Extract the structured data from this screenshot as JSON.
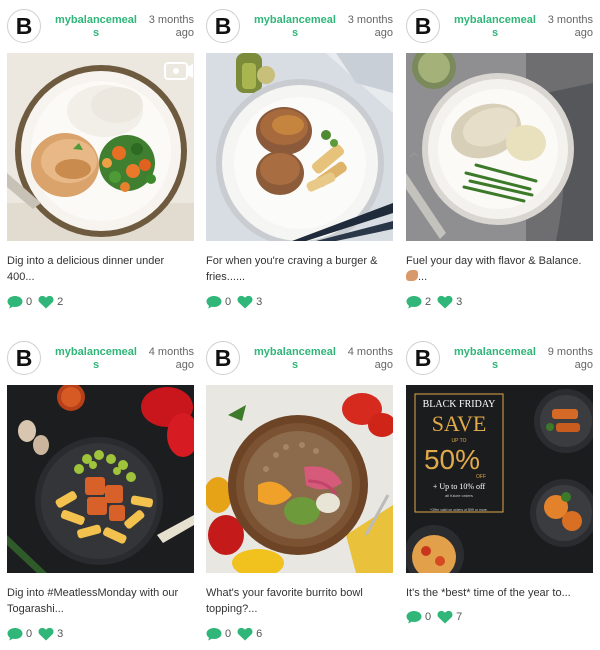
{
  "colors": {
    "accent": "#2fb678",
    "icon": "#2fb678"
  },
  "posts": [
    {
      "avatar_letter": "B",
      "username": "mybalancemeals",
      "time": "3 months ago",
      "caption": "Dig into a delicious dinner under 400...",
      "comments": "0",
      "likes": "2",
      "media": "video-icon",
      "emoji": ""
    },
    {
      "avatar_letter": "B",
      "username": "mybalancemeals",
      "time": "3 months ago",
      "caption": "For when you're craving a burger & fries......",
      "comments": "0",
      "likes": "3",
      "media": "image",
      "emoji": ""
    },
    {
      "avatar_letter": "B",
      "username": "mybalancemeals",
      "time": "3 months ago",
      "caption": "Fuel your day with flavor & Balance.",
      "caption_cont": "...",
      "comments": "2",
      "likes": "3",
      "media": "image",
      "emoji": "flexed-biceps-emoji"
    },
    {
      "avatar_letter": "B",
      "username": "mybalancemeals",
      "time": "4 months ago",
      "caption": "Dig into #MeatlessMonday with our Togarashi...",
      "comments": "0",
      "likes": "3",
      "media": "image",
      "emoji": ""
    },
    {
      "avatar_letter": "B",
      "username": "mybalancemeals",
      "time": "4 months ago",
      "caption": "What's your favorite burrito bowl topping?...",
      "comments": "0",
      "likes": "6",
      "media": "image",
      "emoji": ""
    },
    {
      "avatar_letter": "B",
      "username": "mybalancemeals",
      "time": "9 months ago",
      "caption": "It's the *best* time of the year to...",
      "comments": "0",
      "likes": "7",
      "media": "image",
      "emoji": ""
    }
  ],
  "promo": {
    "line1": "BLACK FRIDAY",
    "save": "SAVE",
    "upto": "UP TO",
    "percent": "50%",
    "off": "OFF",
    "extra": "+ Up to 10% off",
    "extra2": "all future orders",
    "fine": "*Offer valid on orders of $99 or more."
  }
}
